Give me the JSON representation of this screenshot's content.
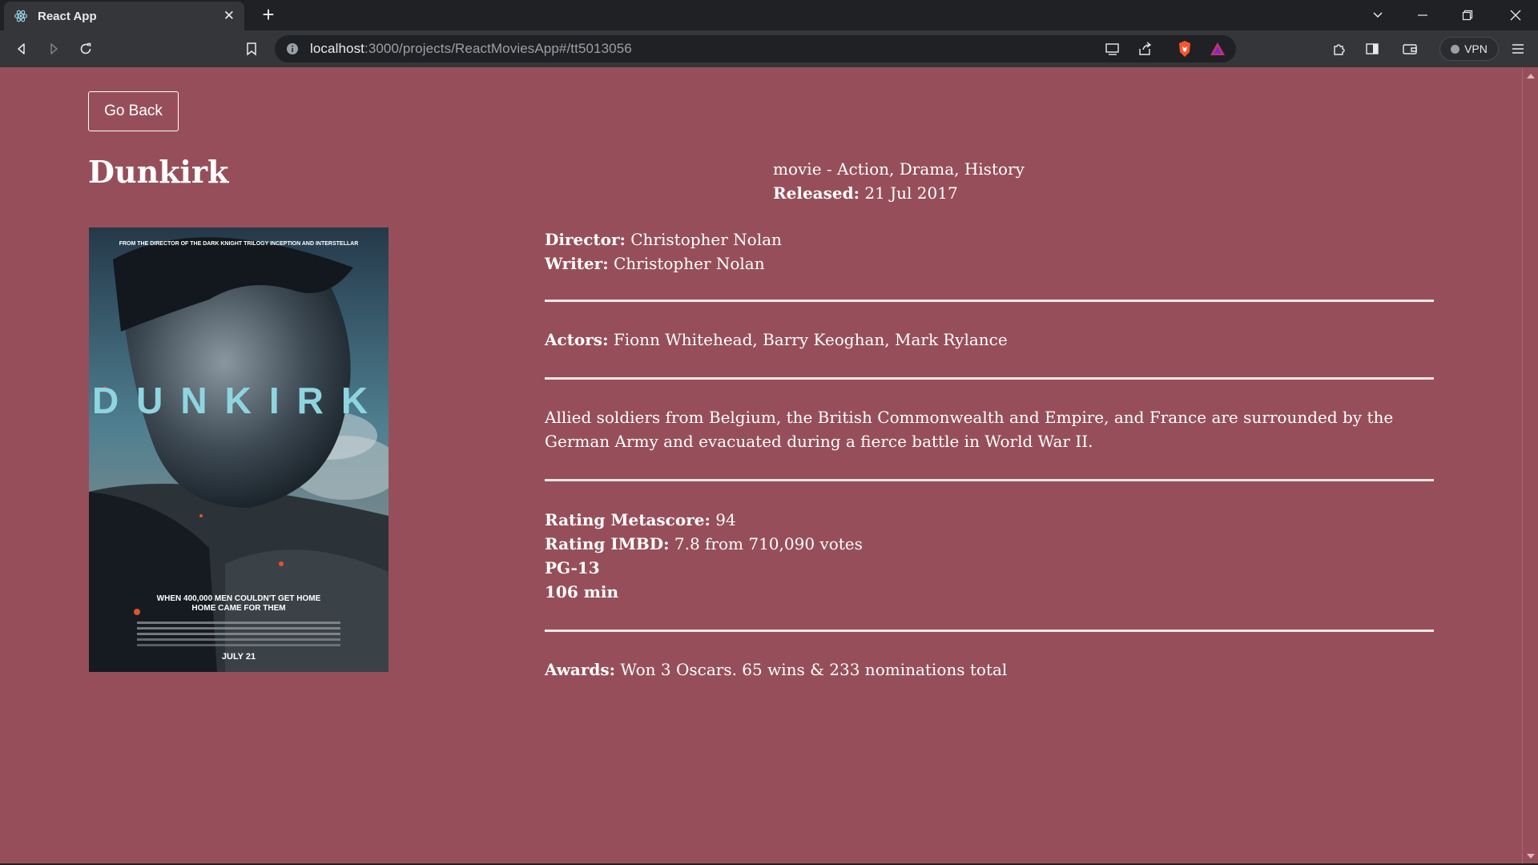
{
  "browser": {
    "tab_title": "React App",
    "url_host": "localhost",
    "url_path": ":3000/projects/ReactMoviesApp#/tt5013056",
    "vpn_label": "VPN"
  },
  "page": {
    "go_back_label": "Go Back",
    "title": "Dunkirk",
    "type_genres": "movie - Action, Drama, History",
    "released_label": "Released:",
    "released_value": "21 Jul 2017",
    "director_label": "Director:",
    "director_value": "Christopher Nolan",
    "writer_label": "Writer:",
    "writer_value": "Christopher Nolan",
    "actors_label": "Actors:",
    "actors_value": "Fionn Whitehead, Barry Keoghan, Mark Rylance",
    "plot": "Allied soldiers from Belgium, the British Commonwealth and Empire, and France are surrounded by the German Army and evacuated during a fierce battle in World War II.",
    "metascore_label": "Rating Metascore:",
    "metascore_value": "94",
    "imdb_label": "Rating IMBD:",
    "imdb_value": "7.8 from 710,090 votes",
    "rated": "PG-13",
    "runtime": "106 min",
    "awards_label": "Awards:",
    "awards_value": "Won 3 Oscars. 65 wins & 233 nominations total",
    "poster": {
      "top_text": "FROM THE DIRECTOR OF THE DARK KNIGHT TRILOGY INCEPTION AND INTERSTELLAR",
      "wordmark": "DUNKIRK",
      "tagline_1": "WHEN 400,000 MEN COULDN'T GET HOME",
      "tagline_2": "HOME CAME FOR THEM",
      "date": "JULY 21"
    }
  },
  "colors": {
    "page_bg": "#964f5a",
    "chrome_dark": "#202124",
    "chrome_toolbar": "#35363a"
  }
}
